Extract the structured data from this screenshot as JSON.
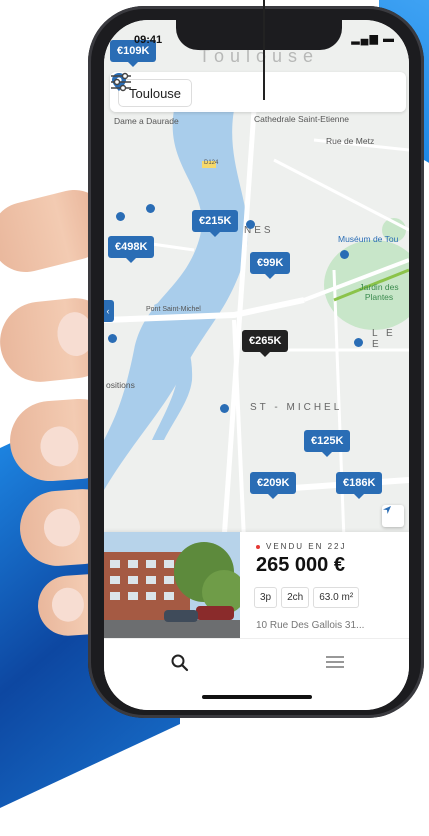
{
  "status": {
    "time": "09:41"
  },
  "map": {
    "city_ghost": "Toulouse",
    "labels": {
      "daurade": "Dame a Daurade",
      "cathedrale": "Cathedrale Saint-Etienne",
      "rue_metz": "Rue de Metz",
      "d124": "D124",
      "carmes": "NES",
      "museum": "Muséum de Tou",
      "jardin": "Jardin des Plantes",
      "pont": "Pont Saint-Michel",
      "positions": "ositions",
      "st_michel": "ST - MICHEL",
      "lee": "L E E"
    },
    "markers": [
      {
        "label": "€109K"
      },
      {
        "label": "€215K"
      },
      {
        "label": "€498K"
      },
      {
        "label": "€99K"
      },
      {
        "label": "€265K",
        "selected": true
      },
      {
        "label": "€125K"
      },
      {
        "label": "€209K"
      },
      {
        "label": "€186K"
      }
    ]
  },
  "search": {
    "city": "Toulouse"
  },
  "listing": {
    "status": "VENDU EN 22J",
    "price": "265 000 €",
    "rooms": "3p",
    "bedrooms": "2ch",
    "area": "63.0 m²",
    "address": "10 Rue Des Gallois 31..."
  },
  "colors": {
    "accent": "#2a6db5",
    "selected": "#222222",
    "sold_dot": "#e53935"
  },
  "icons": {
    "location": "location-pin-icon",
    "filter": "sliders-icon",
    "search": "search-icon",
    "menu": "menu-icon",
    "navigate": "navigation-arrow-icon"
  }
}
